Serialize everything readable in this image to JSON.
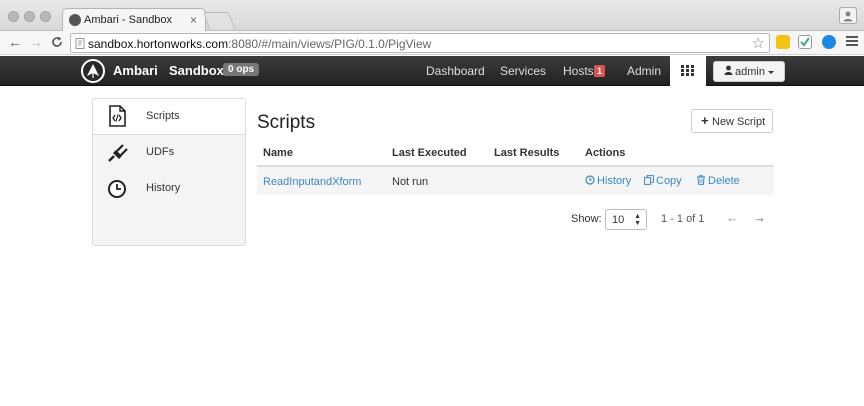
{
  "browser": {
    "tab_title": "Ambari - Sandbox",
    "tab_close": "×",
    "url_host": "sandbox.hortonworks.com",
    "url_path": ":8080/#/main/views/PIG/0.1.0/PigView",
    "back": "←",
    "forward": "→",
    "reload": "C",
    "star": "☆",
    "profile": "👤"
  },
  "navbar": {
    "brand": "Ambari",
    "cluster": "Sandbox",
    "ops_badge": "0 ops",
    "links": [
      "Dashboard",
      "Services",
      "Hosts",
      "Admin"
    ],
    "hosts_alert": "1",
    "user_menu": "admin"
  },
  "sidebar": {
    "items": [
      {
        "label": "Scripts",
        "icon": "script-icon",
        "active": true
      },
      {
        "label": "UDFs",
        "icon": "plug-icon",
        "active": false
      },
      {
        "label": "History",
        "icon": "clock-icon",
        "active": false
      }
    ]
  },
  "main": {
    "title": "Scripts",
    "new_button": "New Script",
    "columns": [
      "Name",
      "Last Executed",
      "Last Results",
      "Actions"
    ],
    "rows": [
      {
        "name": "ReadInputandXform",
        "last_executed": "Not run",
        "last_results": "",
        "actions": [
          "History",
          "Copy",
          "Delete"
        ]
      }
    ],
    "pagination": {
      "show_label": "Show:",
      "page_size": "10",
      "range": "1 - 1 of 1",
      "prev": "←",
      "next": "→"
    }
  },
  "colors": {
    "link": "#3a87c8",
    "navbar": "#2c2c2c",
    "alert": "#d9534f"
  }
}
